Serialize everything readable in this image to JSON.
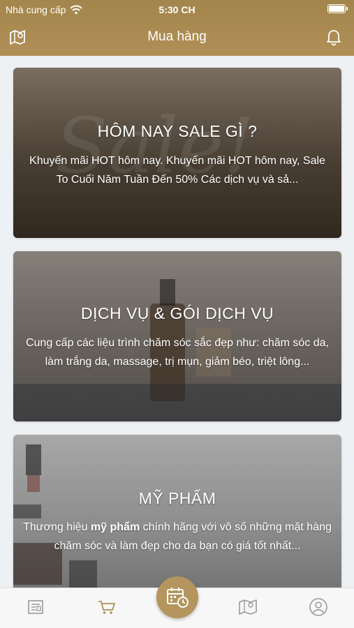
{
  "status_bar": {
    "carrier": "Nhà cung cấp",
    "time": "5:30 CH"
  },
  "nav": {
    "title": "Mua hàng",
    "left_icon": "map-pin-icon",
    "right_icon": "bell-icon"
  },
  "cards": [
    {
      "title": "HÔM NAY SALE GÌ ?",
      "description": "Khuyến mãi HOT hôm nay. Khuyến mãi HOT hôm nay, Sale To Cuối Năm Tuần Đến 50% Các dịch vụ và sả..."
    },
    {
      "title": "DỊCH VỤ & GÓI DỊCH VỤ",
      "description": "Cung cấp các liệu trình chăm sóc sắc đẹp như: chăm sóc da, làm trắng da, massage, trị mụn, giảm béo, triệt lông..."
    },
    {
      "title": "MỸ PHẨM",
      "description_pre": "Thương hiệu ",
      "description_bold": "mỹ phẩm",
      "description_post": " chính hãng với vô số những mặt hàng chăm sóc và làm đẹp cho da bạn có giá tốt nhất..."
    }
  ],
  "tabbar": {
    "tabs": [
      "news-icon",
      "cart-icon",
      "calendar-clock-icon",
      "map-icon",
      "user-icon"
    ],
    "active": "cart-icon"
  },
  "colors": {
    "brand": "#b08f55",
    "tab_inactive": "#9a9a9a",
    "tab_active": "#b08f55"
  }
}
